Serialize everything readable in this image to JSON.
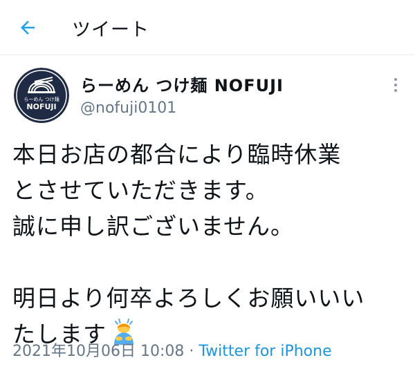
{
  "header": {
    "title": "ツイート",
    "back_icon": "arrow-left-icon",
    "accent_color": "#1da1f2"
  },
  "user": {
    "display_name": "らーめん つけ麺 NOFUJI",
    "handle": "@nofuji0101",
    "avatar_icon": "shop-logo-avatar",
    "avatar_text_top": "らーめん つけ麺",
    "avatar_text_bottom": "NOFUJI"
  },
  "more_icon": "more-vertical-icon",
  "tweet": {
    "lines": [
      "本日お店の都合により臨時休業",
      "とさせていただきます。",
      "誠に申し訳ございません。",
      "",
      "明日より何卒よろしくお願いいい",
      "たします"
    ],
    "emoji_icon": "person-bowing-emoji"
  },
  "meta": {
    "timestamp": "2021年10月06日 10:08",
    "separator": "·",
    "source": "Twitter for iPhone"
  },
  "colors": {
    "text": "#0f1419",
    "muted": "#657786",
    "link": "#1b95e0",
    "divider": "#e6ecf0"
  }
}
